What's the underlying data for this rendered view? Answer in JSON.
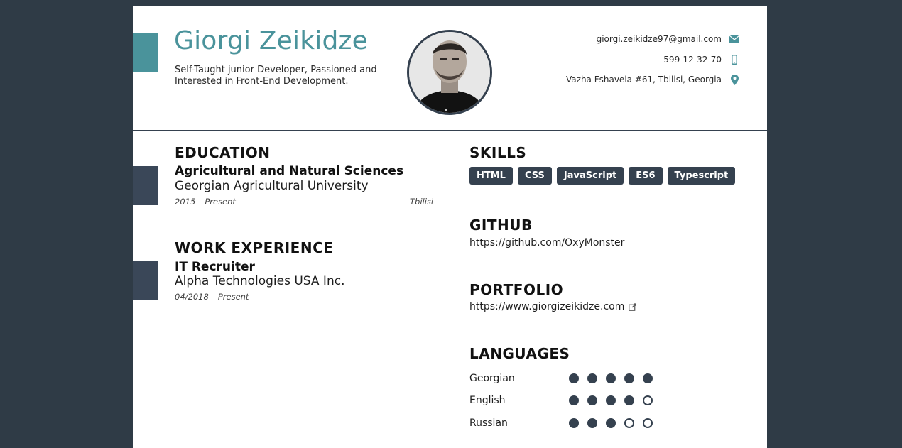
{
  "header": {
    "name": "Giorgi Zeikidze",
    "tagline": "Self-Taught junior Developer, Passioned and Interested in Front-End Development."
  },
  "contact": {
    "email": "giorgi.zeikidze97@gmail.com",
    "phone": "599-12-32-70",
    "address": "Vazha Fshavela #61, Tbilisi, Georgia"
  },
  "education": {
    "title": "EDUCATION",
    "degree": "Agricultural and Natural Sciences",
    "school": "Georgian Agricultural University",
    "dates": "2015 – Present",
    "location": "Tbilisi"
  },
  "work": {
    "title": "WORK EXPERIENCE",
    "role": "IT Recruiter",
    "company": "Alpha Technologies USA Inc.",
    "dates": "04/2018 – Present"
  },
  "skills": {
    "title": "SKILLS",
    "items": [
      "HTML",
      "CSS",
      "JavaScript",
      "ES6",
      "Typescript"
    ]
  },
  "github": {
    "title": "GITHUB",
    "url": "https://github.com/OxyMonster"
  },
  "portfolio": {
    "title": "PORTFOLIO",
    "url": "https://www.giorgizeikidze.com"
  },
  "languages": {
    "title": "LANGUAGES",
    "items": [
      {
        "name": "Georgian",
        "level": 5,
        "max": 5
      },
      {
        "name": "English",
        "level": 4,
        "max": 5
      },
      {
        "name": "Russian",
        "level": 3,
        "max": 5
      }
    ]
  },
  "colors": {
    "accent_teal": "#4a939b",
    "dark": "#35414f",
    "background": "#2f3b46"
  },
  "icons": {
    "email": "envelope-icon",
    "phone": "mobile-phone-icon",
    "address": "map-pin-icon",
    "external": "external-link-icon"
  }
}
